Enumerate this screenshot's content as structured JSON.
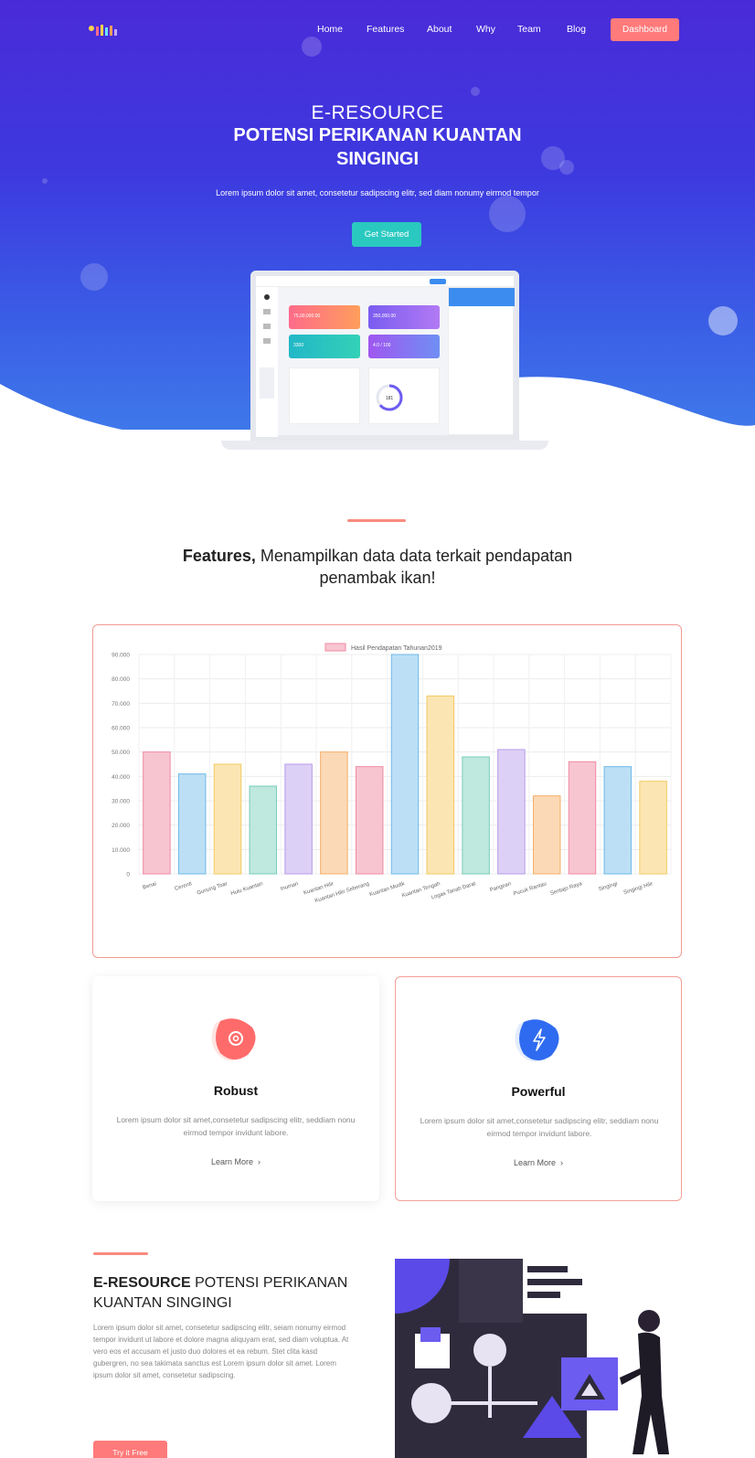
{
  "nav": {
    "links": [
      "Home",
      "Features",
      "About",
      "Why",
      "Team",
      "Blog"
    ],
    "cta": "Dashboard"
  },
  "hero": {
    "line1": "E-RESOURCE",
    "line2": "POTENSI PERIKANAN KUANTAN",
    "line3": "SINGINGI",
    "subtitle": "Lorem ipsum dolor sit amet, consetetur sadipscing elitr, sed diam nonumy eirmod tempor",
    "button": "Get Started"
  },
  "features": {
    "title_bold": "Features,",
    "title_rest": " Menampilkan data data terkait pendapatan",
    "title_line2": "penambak ikan!"
  },
  "chart_data": {
    "type": "bar",
    "legend": [
      "Hasil Pendapatan Tahunan2019"
    ],
    "legend_position": "top-center",
    "grid": true,
    "ylim": [
      0,
      90000
    ],
    "yticks": [
      "0",
      "10.000",
      "20.000",
      "30.000",
      "40.000",
      "50.000",
      "60.000",
      "70.000",
      "80.000",
      "90.000"
    ],
    "categories": [
      "Benai",
      "Cerenti",
      "Gunung Toar",
      "Hulu Kuantan",
      "Inuman",
      "Kuantan Hilir",
      "Kuantan Hilir Seberang",
      "Kuantan Mudik",
      "Kuantan Tengah",
      "Logas Tanah Darat",
      "Pangean",
      "Pucuk Rantau",
      "Sentajo Raya",
      "Singingi",
      "Singingi Hilir"
    ],
    "series": [
      {
        "name": "Hasil Pendapatan Tahunan2019",
        "values": [
          50000,
          41000,
          45000,
          36000,
          45000,
          50000,
          44000,
          98000,
          73000,
          48000,
          51000,
          32000,
          46000,
          44000,
          38000
        ]
      }
    ],
    "colors": [
      "#f7c5d0",
      "#bcdff5",
      "#fbe6b3",
      "#bfe8df",
      "#ddd0f6",
      "#fcd9b6",
      "#f7c5d0",
      "#bcdff5",
      "#fbe6b3",
      "#bfe8df",
      "#ddd0f6",
      "#fcd9b6",
      "#f7c5d0",
      "#bcdff5",
      "#fbe6b3"
    ],
    "stroke_colors": [
      "#f08aa3",
      "#6fb9e8",
      "#f3c85f",
      "#76cdb9",
      "#b79be9",
      "#f5ae68",
      "#f08aa3",
      "#6fb9e8",
      "#f3c85f",
      "#76cdb9",
      "#b79be9",
      "#f5ae68",
      "#f08aa3",
      "#6fb9e8",
      "#f3c85f"
    ]
  },
  "cards": [
    {
      "title": "Robust",
      "text": "Lorem ipsum dolor sit amet,consetetur sadipscing elitr, seddiam nonu eirmod tempor invidunt labore.",
      "link": "Learn More",
      "icon": "gear-icon"
    },
    {
      "title": "Powerful",
      "text": "Lorem ipsum dolor sit amet,consetetur sadipscing elitr, seddiam nonu eirmod tempor invidunt labore.",
      "link": "Learn More",
      "icon": "bolt-icon"
    }
  ],
  "about": {
    "title_bold": "E-RESOURCE",
    "title_rest": " POTENSI PERIKANAN KUANTAN SINGINGI",
    "text": "Lorem ipsum dolor sit amet, consetetur sadipscing elitr, seiam nonumy eirmod tempor invidunt ut labore et dolore magna aliquyam erat, sed diam voluptua. At vero eos et accusam et justo duo dolores et ea rebum. Stet clita kasd gubergren, no sea takimata sanctus est Lorem ipsum dolor sit amet. Lorem ipsum dolor sit amet, consetetur sadipscing.",
    "button": "Try it Free"
  },
  "dashboard_preview": {
    "card_values": [
      "75,00,000.00",
      "350,000.00",
      "3300",
      "4.0 / 100"
    ],
    "donut_value": "181"
  },
  "colors": {
    "accent": "#ff7a7a",
    "teal": "#2ac9c0",
    "hero": "#4a2bd8"
  }
}
